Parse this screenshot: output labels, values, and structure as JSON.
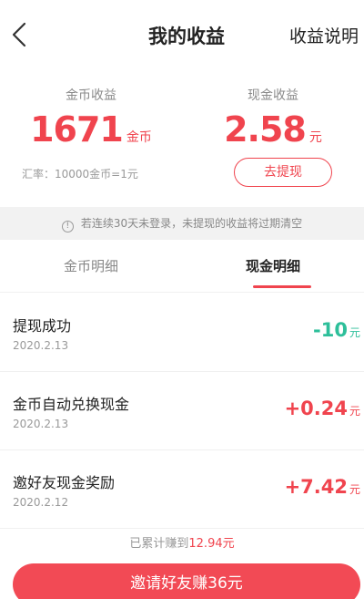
{
  "header": {
    "title": "我的收益",
    "right_link": "收益说明"
  },
  "coins": {
    "label": "金币收益",
    "amount": "1671",
    "unit": "金币",
    "rate": "汇率：10000金币=1元"
  },
  "cash": {
    "label": "现金收益",
    "amount": "2.58",
    "unit": "元",
    "withdraw_label": "去提现"
  },
  "notice": {
    "icon": "info-icon",
    "text": "若连续30天未登录，未提现的收益将过期清空"
  },
  "tabs": [
    {
      "label": "金币明细",
      "active": false
    },
    {
      "label": "现金明细",
      "active": true
    }
  ],
  "records": [
    {
      "title": "提现成功",
      "date": "2020.2.13",
      "amount": "-10",
      "unit": "元",
      "color": "#2dbf9a"
    },
    {
      "title": "金币自动兑换现金",
      "date": "2020.2.13",
      "amount": "+0.24",
      "unit": "元",
      "color": "#f0444e"
    },
    {
      "title": "邀好友现金奖励",
      "date": "2020.2.12",
      "amount": "+7.42",
      "unit": "元",
      "color": "#f0444e"
    }
  ],
  "footer": {
    "total_prefix": "已累计赚到",
    "total_amount": "12.94元",
    "invite_label": "邀请好友赚36元"
  },
  "colors": {
    "accent": "#f0444e",
    "positive": "#f0444e",
    "negative": "#2dbf9a"
  }
}
